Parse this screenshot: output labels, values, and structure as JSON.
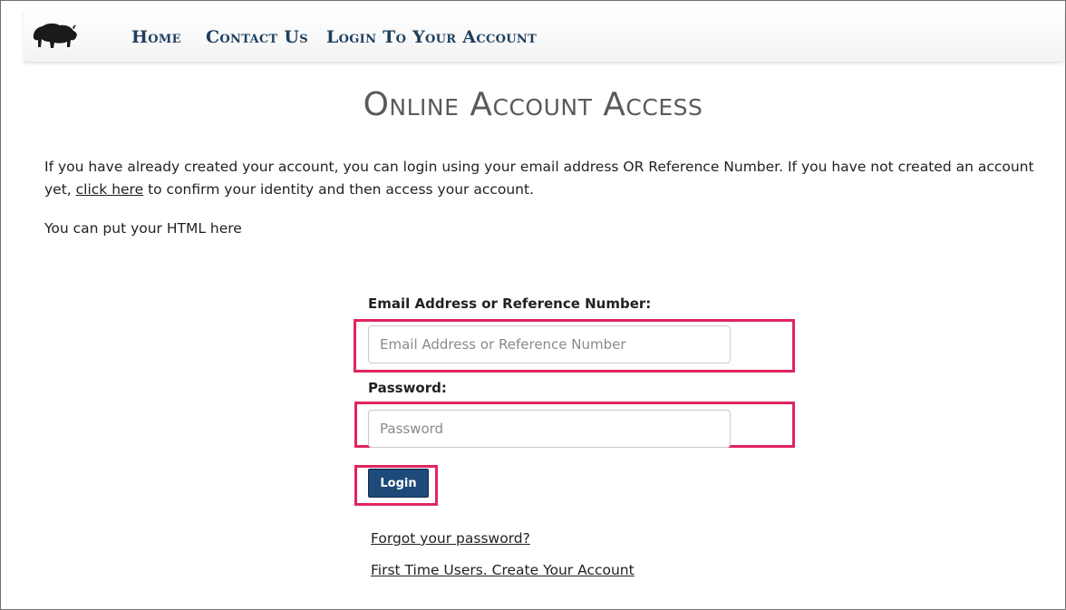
{
  "nav": {
    "logo_icon": "bison-icon",
    "items": [
      {
        "label": "Home"
      },
      {
        "label": "Contact Us"
      },
      {
        "label": "Login To Your Account"
      }
    ]
  },
  "main": {
    "title": "Online Account Access",
    "intro_text": "If you have already created your account, you can login using your email address OR Reference Number. If you have not created an account yet, ",
    "intro_link": "click here",
    "intro_text_end": " to confirm your identity and then access your account.",
    "html_note": "You can put your HTML here"
  },
  "form": {
    "email_label": "Email Address or Reference Number:",
    "email_placeholder": "Email Address or Reference Number",
    "email_value": "",
    "password_label": "Password:",
    "password_placeholder": "Password",
    "password_value": "",
    "login_label": "Login",
    "forgot_link": "Forgot your password?",
    "create_link": "First Time Users. Create Your Account"
  },
  "colors": {
    "nav_text": "#1d3f5f",
    "highlight": "#e3245e",
    "button_bg": "#1d4a78"
  }
}
